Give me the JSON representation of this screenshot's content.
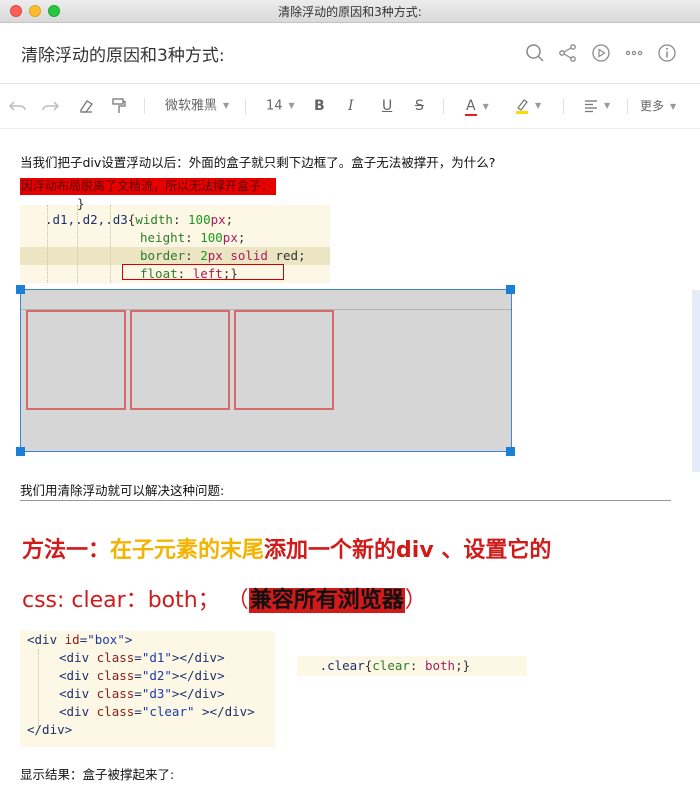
{
  "window": {
    "title": "清除浮动的原因和3种方式:"
  },
  "header": {
    "doc_title": "清除浮动的原因和3种方式:",
    "icons": [
      "search-icon",
      "share-icon",
      "play-icon",
      "more-dots-icon",
      "info-icon"
    ]
  },
  "toolbar": {
    "font_family": "微软雅黑",
    "font_size": "14",
    "bold": "B",
    "italic": "I",
    "underline": "U",
    "strike": "S",
    "font_color": "A",
    "more": "更多"
  },
  "content": {
    "para1": "当我们把子div设置浮动以后：外面的盒子就只剩下边框了。盒子无法被撑开，为什么?",
    "highlight1": "因浮动布局脱离了文档流，所以无法撑开盒子：",
    "code1": {
      "partial": "}",
      "selector": ".d1,.d2,.d3",
      "width_prop": "width",
      "width_val": "100",
      "height_prop": "height",
      "height_val": "100",
      "border_prop": "border",
      "border_num": "2",
      "border_kw": "solid",
      "border_color": "red",
      "float_prop": "float",
      "float_val": "left"
    },
    "para2": "我们用清除浮动就可以解决这种问题:",
    "heading_part1": "方法一：",
    "heading_part2": "在子元素的末尾",
    "heading_part3": "添加一个新的div 、设置它的",
    "heading2_part1": "css: clear：both；  （",
    "heading2_blk": "兼容所有浏览器",
    "heading2_part2": "）",
    "code2": {
      "l1_tag": "div",
      "l1_attr": "id",
      "l1_val": "\"box\"",
      "l2_tag": "div",
      "l2_attr": "class",
      "l2_val": "\"d1\"",
      "l3_tag": "div",
      "l3_attr": "class",
      "l3_val": "\"d2\"",
      "l4_tag": "div",
      "l4_attr": "class",
      "l4_val": "\"d3\"",
      "l5_tag": "div",
      "l5_attr": "class",
      "l5_val": "\"clear\"",
      "l6": "</div>"
    },
    "code3": {
      "selector": ".clear",
      "prop": "clear",
      "val": "both"
    },
    "para3": "显示结果：盒子被撑起来了:"
  },
  "colors": {
    "accent_red": "#d11a1a",
    "accent_yellow": "#f2b400",
    "selection_blue": "#1a7fd6"
  }
}
